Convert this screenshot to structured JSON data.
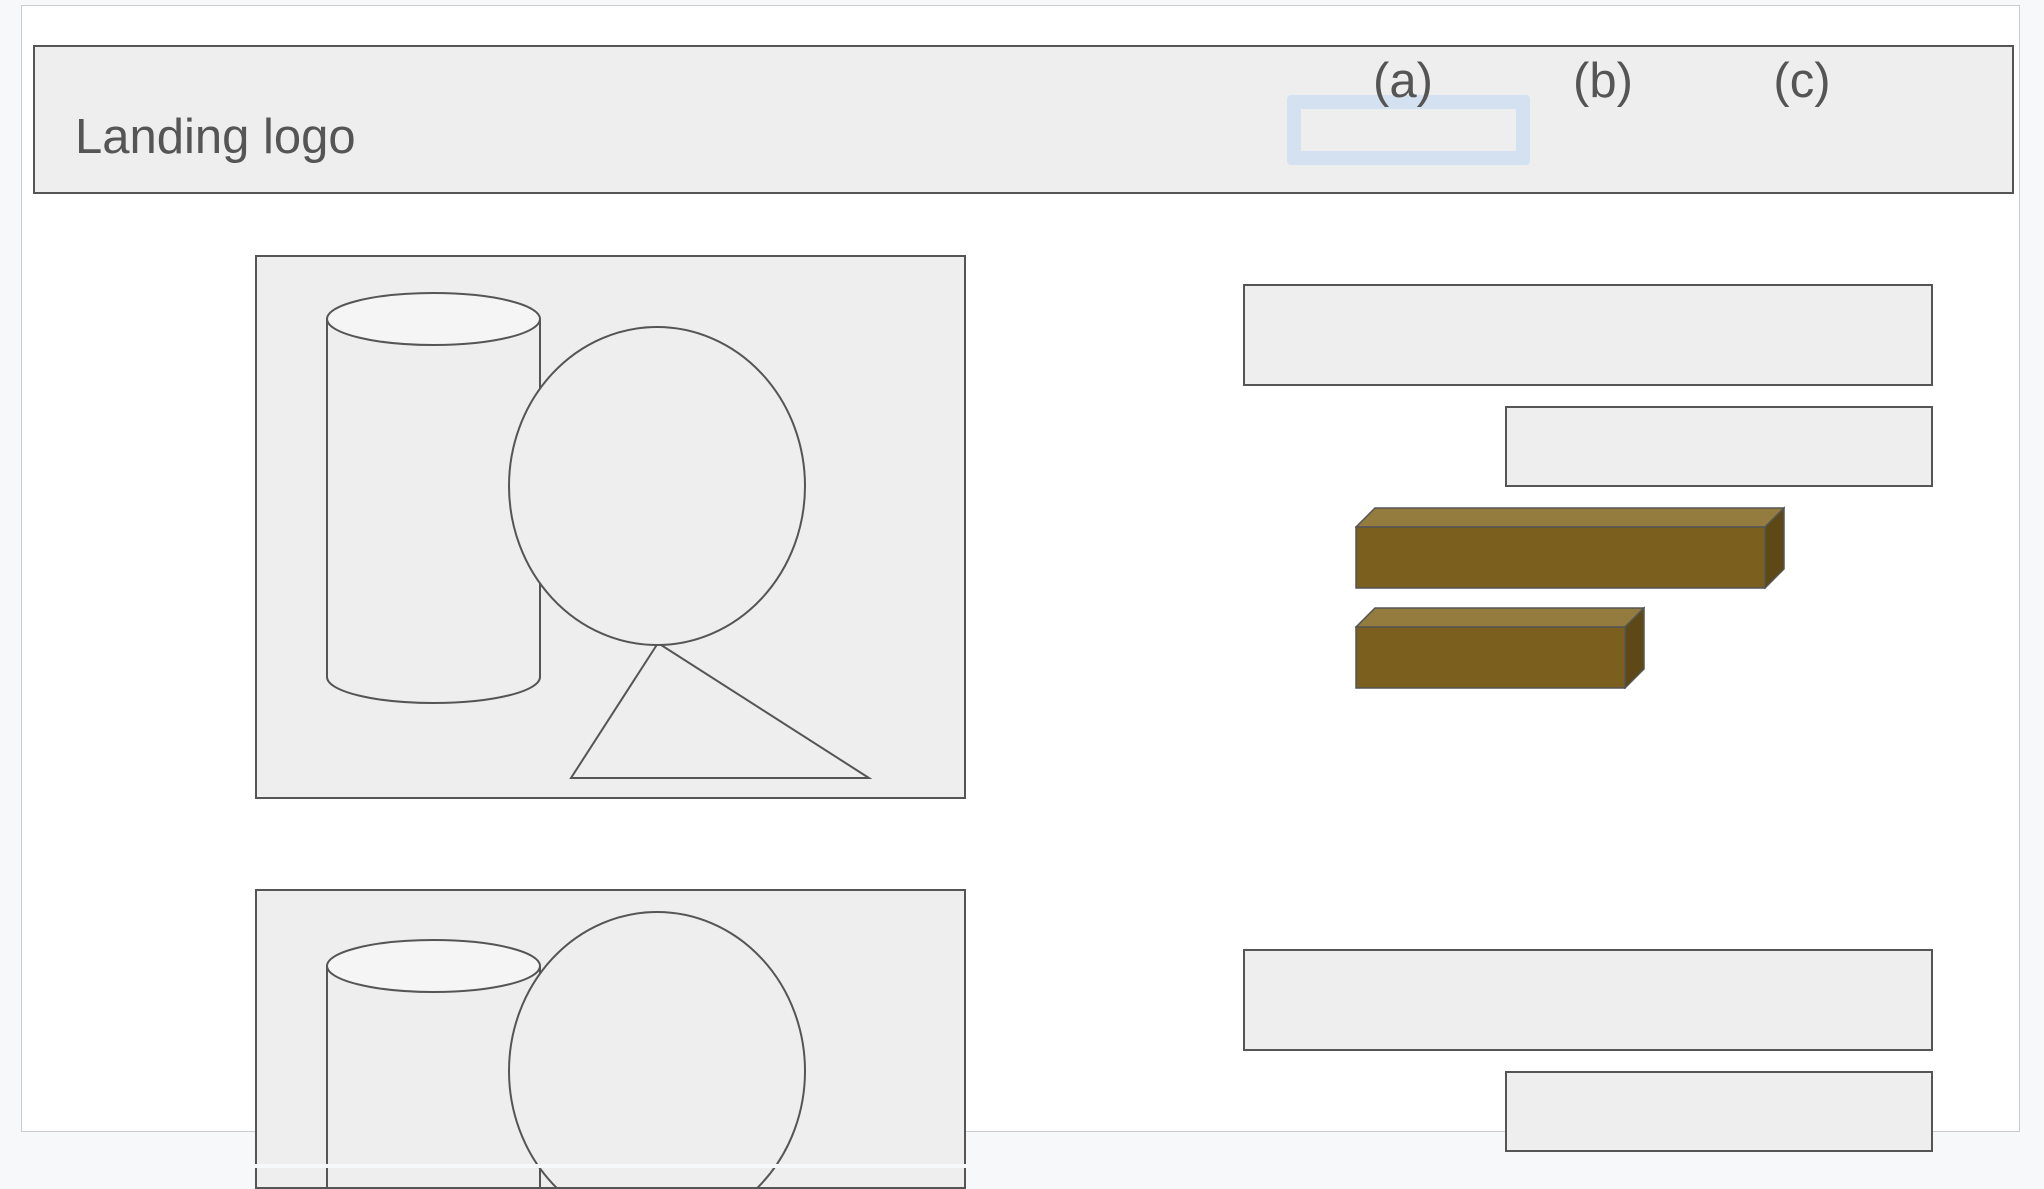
{
  "header": {
    "logo_label": "Landing logo",
    "nav": [
      {
        "label": "(a)",
        "selected": true
      },
      {
        "label": "(b)",
        "selected": false
      },
      {
        "label": "(c)",
        "selected": false
      }
    ]
  },
  "colors": {
    "panel_fill": "#eeeeee",
    "outline": "#555555",
    "selection_highlight": "#d4e1f0",
    "button_front": "#7a5f1e",
    "button_top": "#947c3e",
    "button_side": "#5e4815"
  },
  "content": {
    "image_placeholders": [
      {
        "icons": [
          "cylinder-icon",
          "circle-icon",
          "triangle-icon"
        ]
      },
      {
        "icons": [
          "cylinder-icon",
          "circle-icon"
        ]
      }
    ],
    "text_placeholders": [
      "heading-block",
      "subtext-block",
      "heading-block",
      "subtext-block"
    ],
    "buttons": [
      "primary-button",
      "secondary-button"
    ]
  }
}
